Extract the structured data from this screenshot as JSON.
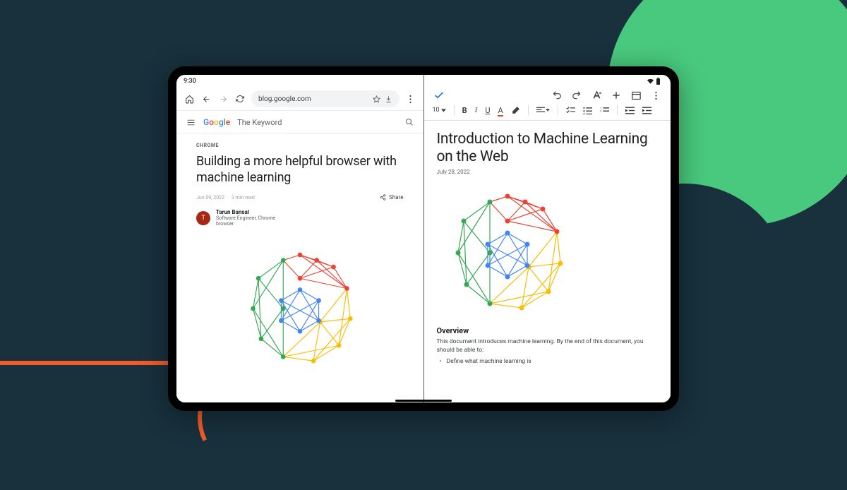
{
  "status": {
    "time": "9:30"
  },
  "chrome": {
    "url": "blog.google.com",
    "site_section": "The Keyword",
    "article": {
      "category": "CHROME",
      "title": "Building a more helpful browser with machine learning",
      "date": "Jun 09, 2022",
      "read_time": "3 min read",
      "share_label": "Share",
      "author": {
        "initial": "T",
        "name": "Tarun Bansal",
        "title": "Software Engineer, Chrome browser"
      }
    }
  },
  "docs": {
    "font_size": "10",
    "title": "Introduction to Machine Learning on the Web",
    "date": "July 28, 2022",
    "overview_heading": "Overview",
    "overview_text": "This document introduces machine learning. By the end of this document, you should be able to:",
    "bullet1": "Define what machine learning is"
  }
}
